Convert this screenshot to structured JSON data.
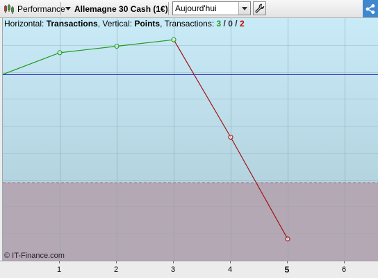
{
  "toolbar": {
    "performance_label": "Performance",
    "instrument_label": "Allemagne 30 Cash (1€)",
    "period_select": {
      "value": "Aujourd'hui"
    },
    "icons": {
      "performance": "candlestick-chart-icon",
      "settings": "wrench-icon",
      "share": "share-icon"
    },
    "share_color": "#3f88cf"
  },
  "chart_header": {
    "horizontal_label": "Horizontal:",
    "horizontal_value": "Transactions",
    "vertical_label": "Vertical:",
    "vertical_value": "Points",
    "transactions_label": "Transactions:",
    "count_win": "3",
    "count_neutral": "0",
    "count_loss": "2",
    "slash1": "/",
    "slash2": "/"
  },
  "copyright": "© IT-Finance.com",
  "chart_data": {
    "type": "line",
    "x": [
      0,
      1,
      2,
      3,
      4,
      5
    ],
    "values": [
      0,
      1,
      1.3,
      1.6,
      -2.9,
      -7.6
    ],
    "x_tick_labels": [
      "1",
      "2",
      "3",
      "4",
      "5",
      "6"
    ],
    "current_x_label": "5",
    "xlim": [
      0,
      6.5
    ],
    "ylim": [
      -8.6,
      2.6
    ],
    "baseline": 0,
    "grid": true,
    "shaded_loss_zone_below": -5,
    "colors": {
      "gain": "#1f9a1f",
      "loss": "#a01414",
      "baseline": "#2323c8",
      "loss_zone": "#b4a8b4",
      "background_top": "#c9ebf7",
      "background_bottom": "#a9c8d4"
    }
  }
}
